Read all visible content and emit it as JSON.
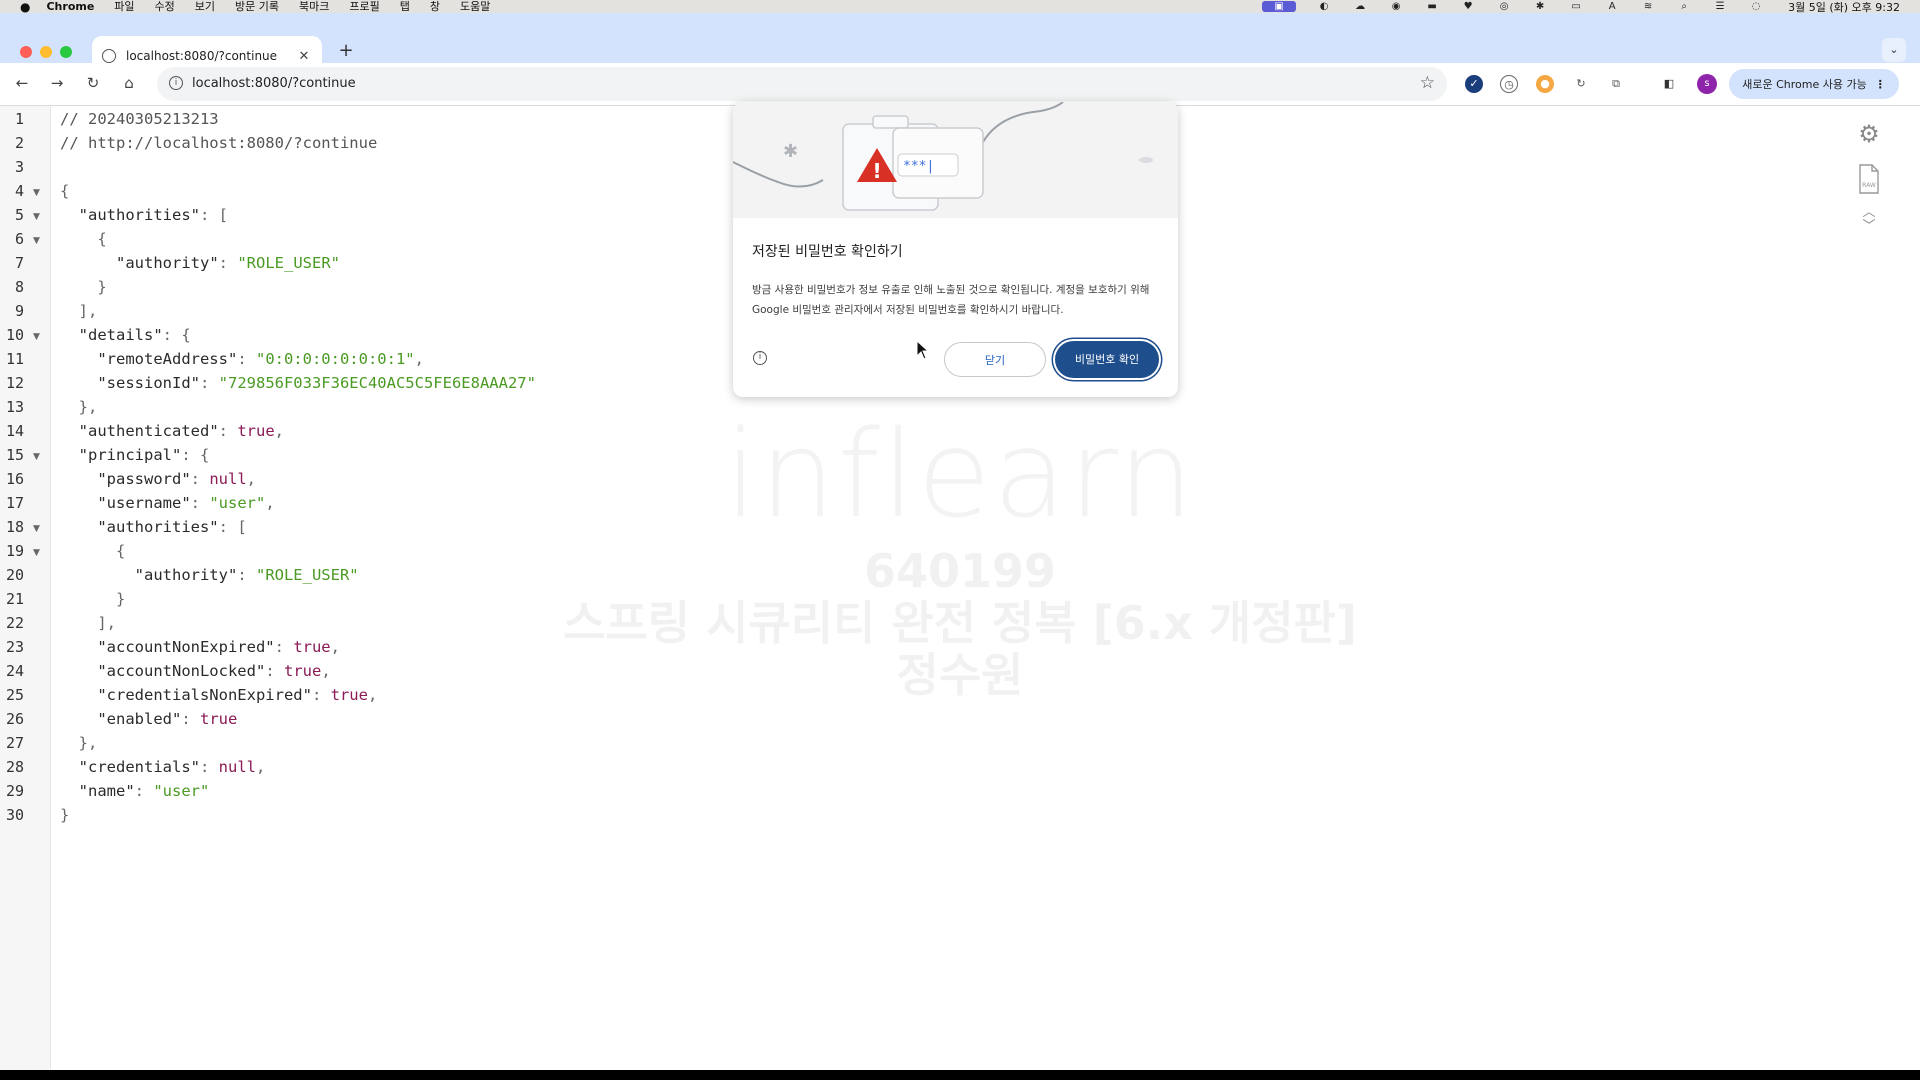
{
  "menubar": {
    "app": "Chrome",
    "items": [
      "파일",
      "수정",
      "보기",
      "방문 기록",
      "북마크",
      "프로필",
      "탭",
      "창",
      "도움말"
    ],
    "clock": "3월 5일 (화) 오후 9:32"
  },
  "tab": {
    "title": "localhost:8080/?continue",
    "close": "✕",
    "new": "+"
  },
  "toolbar": {
    "url": "localhost:8080/?continue",
    "update_label": "새로운 Chrome 사용 가능",
    "profile_initial": "s"
  },
  "code": {
    "line_numbers": [
      "1",
      "2",
      "3",
      "4",
      "5",
      "6",
      "7",
      "8",
      "9",
      "10",
      "11",
      "12",
      "13",
      "14",
      "15",
      "16",
      "17",
      "18",
      "19",
      "20",
      "21",
      "22",
      "23",
      "24",
      "25",
      "26",
      "27",
      "28",
      "29",
      "30"
    ],
    "comment_timestamp": "// 20240305213213",
    "comment_url": "// http://localhost:8080/?continue",
    "keys": {
      "authorities": "\"authorities\"",
      "authority": "\"authority\"",
      "details": "\"details\"",
      "remoteAddress": "\"remoteAddress\"",
      "sessionId": "\"sessionId\"",
      "authenticated": "\"authenticated\"",
      "principal": "\"principal\"",
      "password": "\"password\"",
      "username": "\"username\"",
      "accountNonExpired": "\"accountNonExpired\"",
      "accountNonLocked": "\"accountNonLocked\"",
      "credentialsNonExpired": "\"credentialsNonExpired\"",
      "enabled": "\"enabled\"",
      "credentials": "\"credentials\"",
      "name": "\"name\""
    },
    "values": {
      "role_user": "\"ROLE_USER\"",
      "remote_address": "\"0:0:0:0:0:0:0:1\"",
      "session_id": "\"729856F033F36EC40AC5C5FE6E8AAA27\"",
      "true": "true",
      "null": "null",
      "user": "\"user\""
    }
  },
  "watermark": {
    "logo": "inflearn",
    "id": "640199",
    "course": "스프링 시큐리티 완전 정복 [6.x 개정판]",
    "name": "정수원"
  },
  "dialog": {
    "illustration_text": "***|",
    "title": "저장된 비밀번호 확인하기",
    "body": "방금 사용한 비밀번호가 정보 유출로 인해 노출된 것으로 확인됩니다. 계정을 보호하기 위해 Google 비밀번호 관리자에서 저장된 비밀번호를 확인하시기 바랍니다.",
    "close_label": "닫기",
    "confirm_label": "비밀번호 확인"
  },
  "colors": {
    "tabstrip": "#d3e3fd",
    "string": "#4a9a23",
    "literal": "#8b1a55",
    "primary_button": "#1f4e8c"
  }
}
